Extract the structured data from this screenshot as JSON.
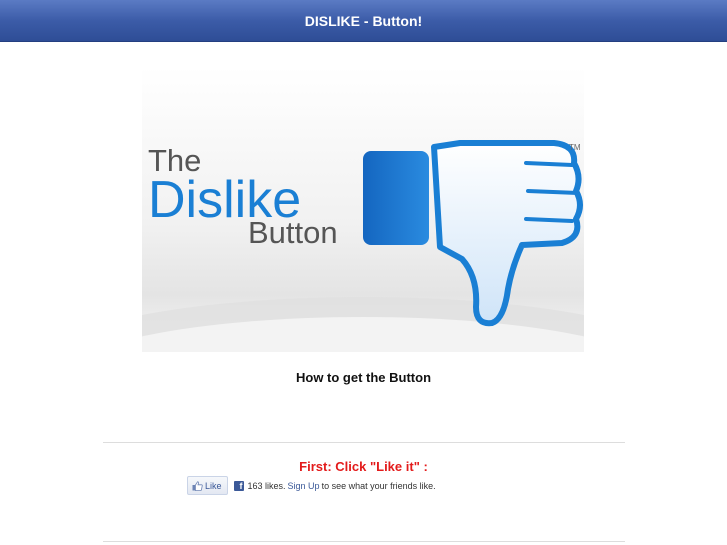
{
  "header": {
    "title": "DISLIKE - Button!"
  },
  "banner": {
    "line1": "The",
    "line2": "Dislike",
    "line3": "Button",
    "trademark": "TM"
  },
  "content": {
    "howto": "How to get the Button",
    "first_step": "First: Click \"Like it\" :"
  },
  "facebook": {
    "like_label": "Like",
    "fb_letter": "f",
    "likes_text": "163 likes.",
    "signup_label": "Sign Up",
    "suffix_text": "to see what your friends like."
  },
  "colors": {
    "header_blue": "#3c5ca8",
    "accent_red": "#e31b1b",
    "dislike_blue": "#1a7fd4",
    "fb_blue": "#3b5998"
  }
}
